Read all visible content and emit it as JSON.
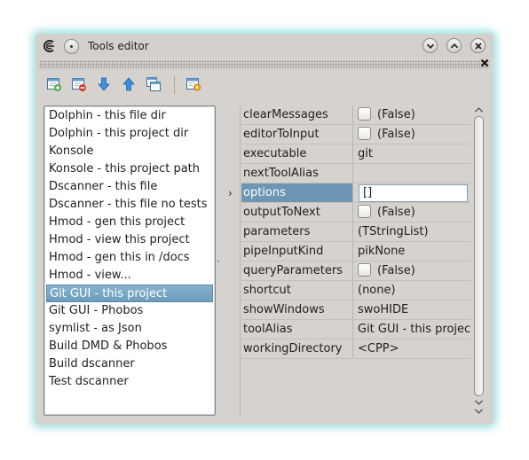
{
  "window": {
    "title": "Tools editor"
  },
  "toolbar": {
    "buttons": [
      {
        "icon": "add-item-icon"
      },
      {
        "icon": "remove-item-icon"
      },
      {
        "icon": "move-down-icon"
      },
      {
        "icon": "move-up-icon"
      },
      {
        "icon": "clone-item-icon"
      },
      {
        "icon": "run-tool-icon"
      }
    ]
  },
  "tools": [
    "Dolphin - this file dir",
    "Dolphin - this project dir",
    "Konsole",
    "Konsole - this project path",
    "Dscanner - this file",
    "Dscanner - this file no tests",
    "Hmod - gen this project",
    "Hmod - view this project",
    "Hmod - gen this in /docs",
    "Hmod - view...",
    "Git GUI - this project",
    "Git GUI - Phobos",
    "symlist - as Json",
    "Build DMD & Phobos",
    "Build dscanner",
    "Test dscanner"
  ],
  "selected_tool": "Git GUI - this project",
  "properties": [
    {
      "name": "clearMessages",
      "value": "(False)",
      "checkbox": true
    },
    {
      "name": "editorToInput",
      "value": "(False)",
      "checkbox": true
    },
    {
      "name": "executable",
      "value": "git"
    },
    {
      "name": "nextToolAlias",
      "value": ""
    },
    {
      "name": "options",
      "value": "[]",
      "editing": true
    },
    {
      "name": "outputToNext",
      "value": "(False)",
      "checkbox": true
    },
    {
      "name": "parameters",
      "value": "(TStringList)"
    },
    {
      "name": "pipeInputKind",
      "value": "pikNone"
    },
    {
      "name": "queryParameters",
      "value": "(False)",
      "checkbox": true
    },
    {
      "name": "shortcut",
      "value": "(none)"
    },
    {
      "name": "showWindows",
      "value": "swoHIDE"
    },
    {
      "name": "toolAlias",
      "value": "Git GUI - this project"
    },
    {
      "name": "workingDirectory",
      "value": "<CPP>"
    }
  ],
  "colors": {
    "selection": "#6c96b3",
    "glow": "#5ac8c8",
    "window_bg": "#d6d2cd"
  }
}
